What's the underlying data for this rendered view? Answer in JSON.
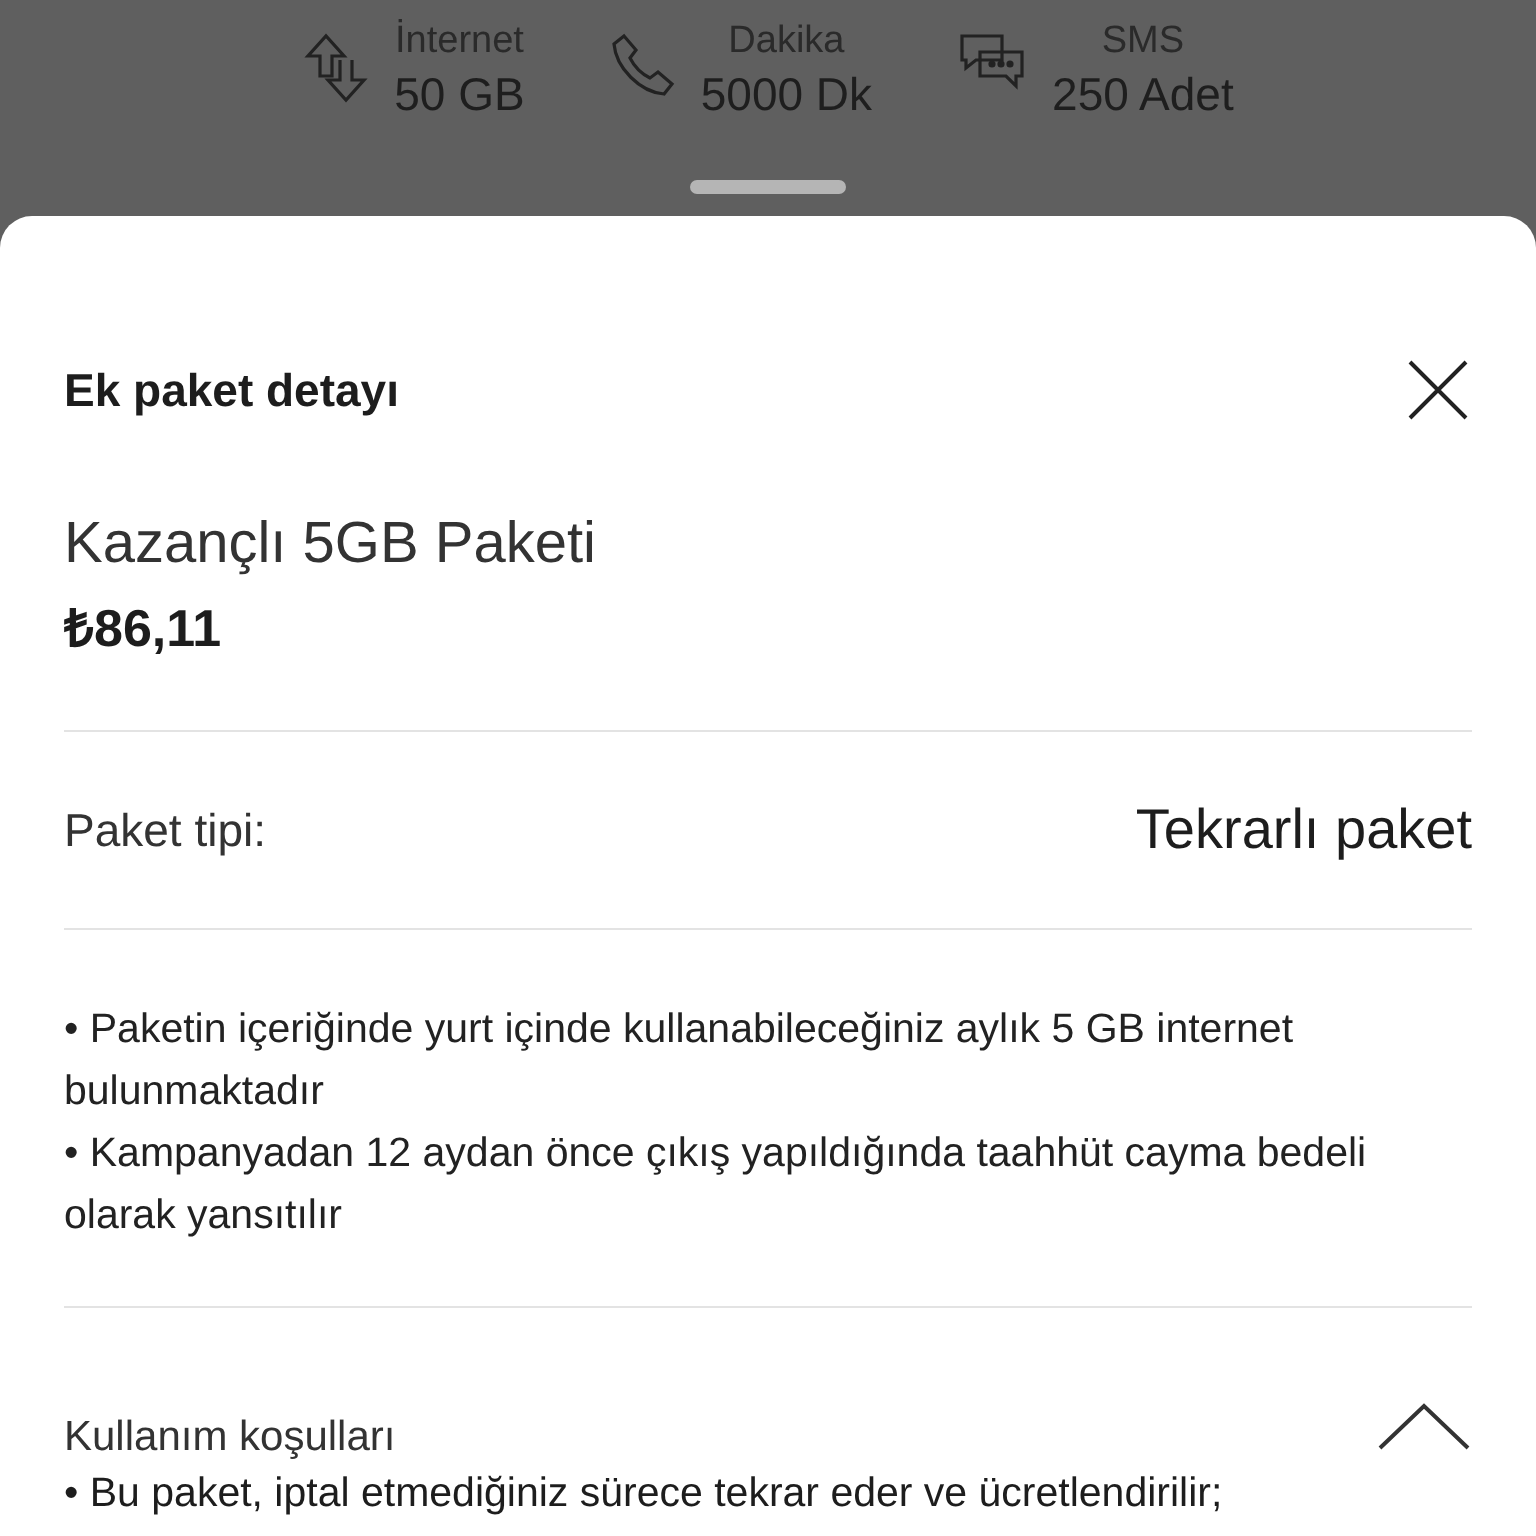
{
  "summary": [
    {
      "kind": "data",
      "label": "İnternet",
      "value": "50 GB"
    },
    {
      "kind": "call",
      "label": "Dakika",
      "value": "5000 Dk"
    },
    {
      "kind": "sms",
      "label": "SMS",
      "value": "250 Adet"
    }
  ],
  "sheet": {
    "title": "Ek paket detayı",
    "package_name": "Kazançlı 5GB Paketi",
    "price": "₺86,11",
    "type_label": "Paket tipi:",
    "type_value": "Tekrarlı paket",
    "description": [
      "• Paketin içeriğinde yurt içinde kullanabileceğiniz aylık 5 GB internet bulunmaktadır",
      "• Kampanyadan 12 aydan önce çıkış yapıldığında taahhüt cayma bedeli olarak yansıtılır"
    ],
    "terms": {
      "title": "Kullanım koşulları",
      "expanded": true,
      "lines": [
        "• Bu paket, iptal etmediğiniz sürece tekrar eder ve ücretlendirilir;"
      ]
    }
  }
}
